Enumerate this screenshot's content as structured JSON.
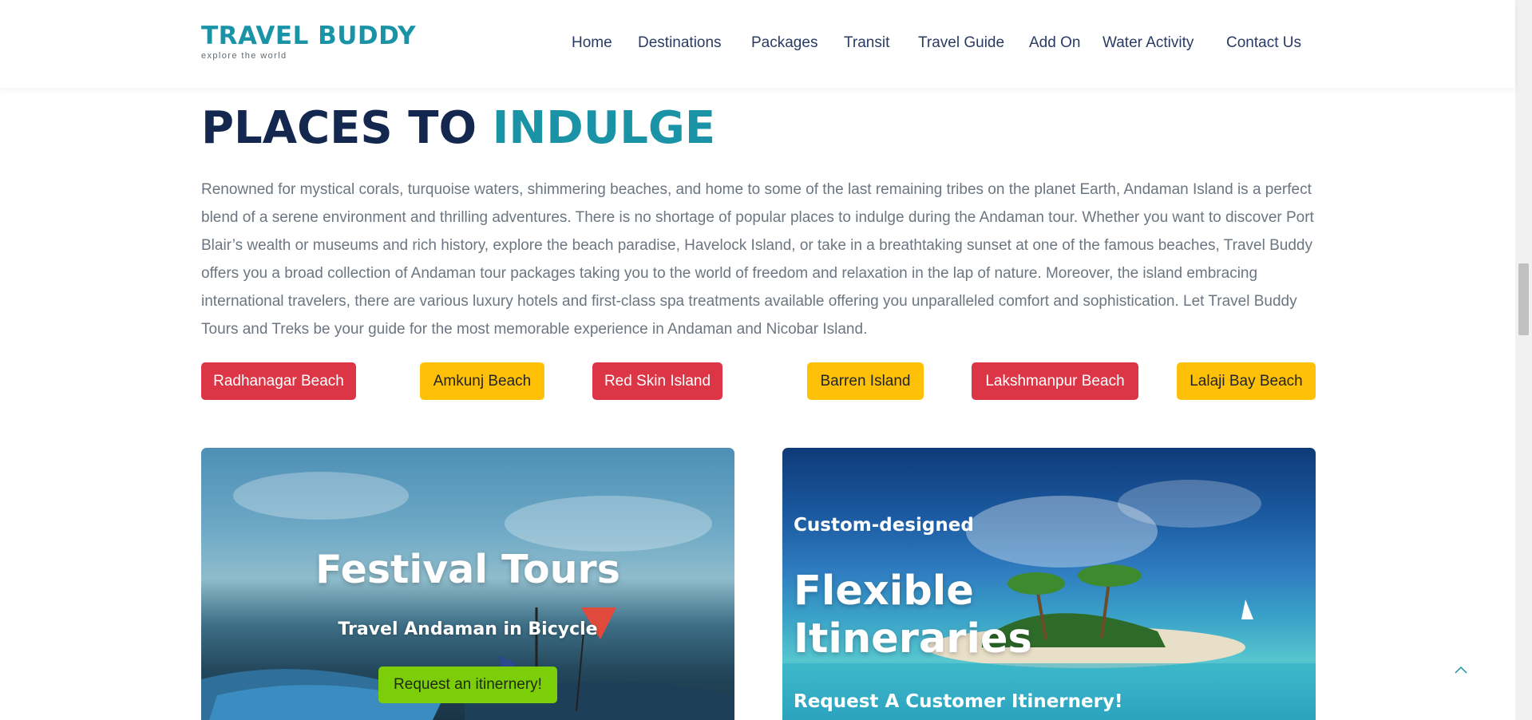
{
  "brand": {
    "title": "TRAVEL BUDDY",
    "tagline": "explore the world"
  },
  "nav": {
    "items": [
      {
        "label": "Home"
      },
      {
        "label": "Destinations"
      },
      {
        "label": "Packages"
      },
      {
        "label": "Transit"
      },
      {
        "label": "Travel Guide"
      },
      {
        "label": "Add On"
      },
      {
        "label": "Water Activity"
      },
      {
        "label": "Contact Us"
      }
    ]
  },
  "section": {
    "heading_part1": "PLACES TO",
    "heading_part2": "INDULGE",
    "intro": "Renowned for mystical corals, turquoise waters, shimmering beaches, and home to some of the last remaining tribes on the planet Earth, Andaman Island is a perfect blend of a serene environment and thrilling adventures. There is no shortage of popular places to indulge during the Andaman tour. Whether you want to discover Port Blair’s wealth or museums and rich history, explore the beach paradise, Havelock Island, or take in a breathtaking sunset at one of the famous beaches, Travel Buddy offers you a broad collection of Andaman tour packages taking you to the world of freedom and relaxation in the lap of nature. Moreover, the island embracing international travelers, there are various luxury hotels and first-class spa treatments available offering you unparalleled comfort and sophistication. Let Travel Buddy Tours and Treks be your guide for the most memorable experience in Andaman and Nicobar Island."
  },
  "places": [
    {
      "label": "Radhanagar Beach",
      "color": "red"
    },
    {
      "label": "Amkunj Beach",
      "color": "yellow"
    },
    {
      "label": "Red Skin Island",
      "color": "red"
    },
    {
      "label": "Barren Island",
      "color": "yellow"
    },
    {
      "label": "Lakshmanpur Beach",
      "color": "red"
    },
    {
      "label": "Lalaji Bay Beach",
      "color": "yellow"
    }
  ],
  "cards": {
    "festival": {
      "title": "Festival Tours",
      "subtitle": "Travel Andaman in Bicycle",
      "button": "Request an itinernery!"
    },
    "flexible": {
      "pretitle": "Custom-designed",
      "title": "Flexible Itineraries",
      "subtitle": "Request A Customer Itinernery!"
    }
  },
  "colors": {
    "brand_teal": "#1b93a7",
    "navy": "#14284f",
    "tag_red": "#dc3545",
    "tag_yellow": "#ffc107",
    "cta_green": "#7cce08"
  },
  "icons": {
    "back_to_top": "chevron-up-icon"
  }
}
